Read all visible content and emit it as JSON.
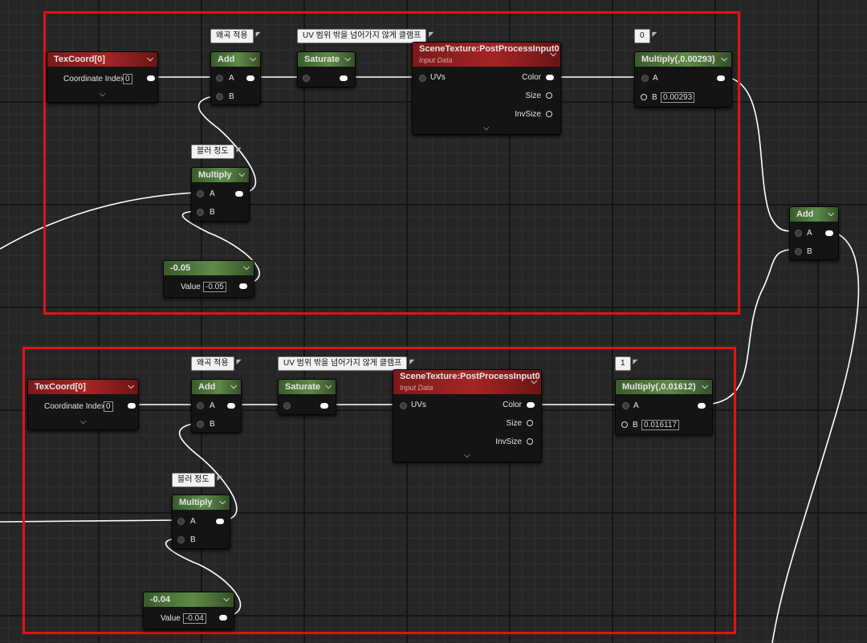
{
  "top": {
    "texcoord": {
      "title": "TexCoord[0]",
      "coordinate_label": "Coordinate Index",
      "coordinate_value": "0"
    },
    "add": {
      "title": "Add",
      "pin_a": "A",
      "pin_b": "B",
      "comment": "왜곡 적용"
    },
    "saturate": {
      "title": "Saturate",
      "comment": "UV 범위 밖을 넘어가지 않게 클램프"
    },
    "scene": {
      "title": "SceneTexture:PostProcessInput0",
      "subtitle": "Input Data",
      "uvs": "UVs",
      "color": "Color",
      "size": "Size",
      "invsize": "InvSize"
    },
    "multiply_blur": {
      "title": "Multiply",
      "pin_a": "A",
      "pin_b": "B",
      "comment": "블러 정도"
    },
    "constant": {
      "title": "-0.05",
      "value_label": "Value",
      "value": "-0.05"
    },
    "multiply_out": {
      "title": "Multiply(,0.00293)",
      "pin_a": "A",
      "pin_b": "B",
      "b_value": "0.00293",
      "comment": "0"
    }
  },
  "bottom": {
    "texcoord": {
      "title": "TexCoord[0]",
      "coordinate_label": "Coordinate Index",
      "coordinate_value": "0"
    },
    "add": {
      "title": "Add",
      "pin_a": "A",
      "pin_b": "B",
      "comment": "왜곡 적용"
    },
    "saturate": {
      "title": "Saturate",
      "comment": "UV 범위 밖을 넘어가지 않게 클램프"
    },
    "scene": {
      "title": "SceneTexture:PostProcessInput0",
      "subtitle": "Input Data",
      "uvs": "UVs",
      "color": "Color",
      "size": "Size",
      "invsize": "InvSize"
    },
    "multiply_blur": {
      "title": "Multiply",
      "pin_a": "A",
      "pin_b": "B",
      "comment": "블러 정도"
    },
    "constant": {
      "title": "-0.04",
      "value_label": "Value",
      "value": "-0.04"
    },
    "multiply_out": {
      "title": "Multiply(,0.01612)",
      "pin_a": "A",
      "pin_b": "B",
      "b_value": "0.016117",
      "comment": "1"
    }
  },
  "final_add": {
    "title": "Add",
    "pin_a": "A",
    "pin_b": "B"
  },
  "colors": {
    "group_outline": "#e01414",
    "header_red": "#a42525",
    "header_green": "#5e8a48",
    "wire": "#ffffff"
  }
}
